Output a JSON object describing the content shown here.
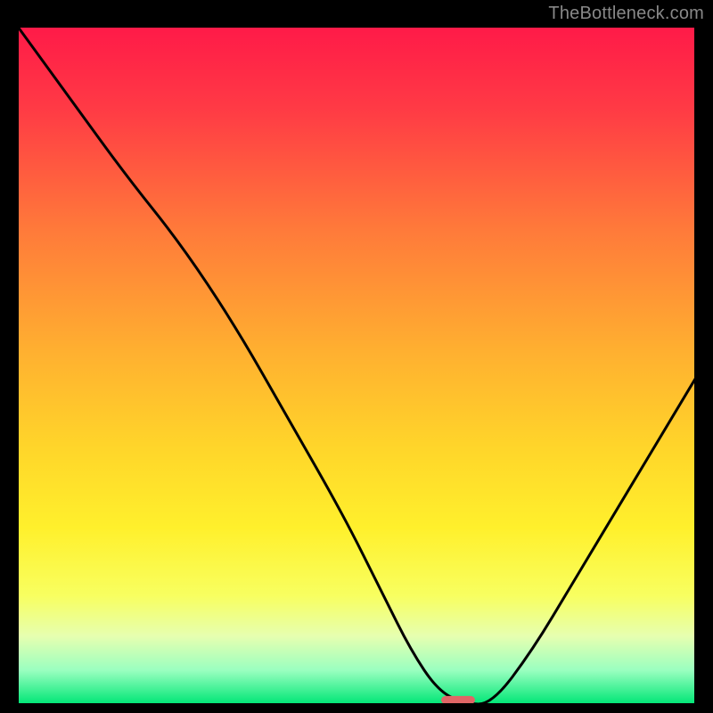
{
  "watermark": "TheBottleneck.com",
  "chart_data": {
    "type": "line",
    "title": "",
    "xlabel": "",
    "ylabel": "",
    "xlim": [
      0,
      100
    ],
    "ylim": [
      0,
      100
    ],
    "series": [
      {
        "name": "bottleneck-curve",
        "x": [
          0,
          8,
          16,
          24,
          32,
          40,
          48,
          54,
          58,
          62,
          66,
          70,
          76,
          82,
          88,
          94,
          100
        ],
        "y": [
          100,
          89,
          78,
          68,
          56,
          42,
          28,
          16,
          8,
          2,
          0,
          0,
          8,
          18,
          28,
          38,
          48
        ]
      }
    ],
    "marker": {
      "name": "optimal-point",
      "x": 65,
      "y": 0,
      "width": 5,
      "height": 1.2,
      "color": "#e06666"
    },
    "background_gradient": {
      "stops": [
        {
          "offset": 0.0,
          "color": "#ff1a48"
        },
        {
          "offset": 0.12,
          "color": "#ff3a45"
        },
        {
          "offset": 0.3,
          "color": "#ff7a3a"
        },
        {
          "offset": 0.48,
          "color": "#ffb030"
        },
        {
          "offset": 0.62,
          "color": "#ffd52a"
        },
        {
          "offset": 0.74,
          "color": "#fff02c"
        },
        {
          "offset": 0.84,
          "color": "#f8ff60"
        },
        {
          "offset": 0.9,
          "color": "#e6ffb0"
        },
        {
          "offset": 0.95,
          "color": "#9affc0"
        },
        {
          "offset": 1.0,
          "color": "#00e676"
        }
      ]
    },
    "plot_frame": {
      "stroke": "#000000",
      "stroke_width": 2
    }
  }
}
